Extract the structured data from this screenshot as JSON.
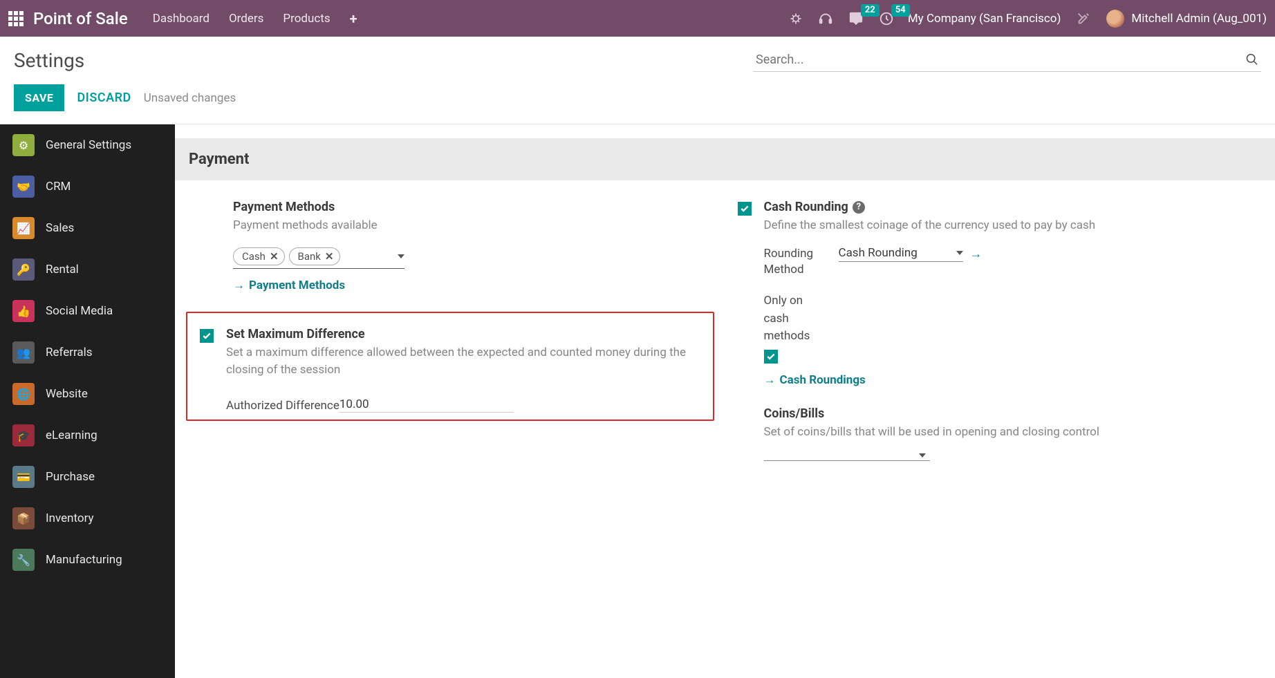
{
  "topbar": {
    "brand": "Point of Sale",
    "menu": [
      "Dashboard",
      "Orders",
      "Products"
    ],
    "badge_messages": "22",
    "badge_activities": "54",
    "company": "My Company (San Francisco)",
    "user": "Mitchell Admin (Aug_001)"
  },
  "page": {
    "title": "Settings",
    "search_placeholder": "Search...",
    "save": "SAVE",
    "discard": "DISCARD",
    "unsaved": "Unsaved changes"
  },
  "sidebar": {
    "items": [
      {
        "label": "General Settings",
        "color": "#8fae3e"
      },
      {
        "label": "CRM",
        "color": "#4b5ea3"
      },
      {
        "label": "Sales",
        "color": "#d98a2b"
      },
      {
        "label": "Rental",
        "color": "#5a5a7a"
      },
      {
        "label": "Social Media",
        "color": "#c9325a"
      },
      {
        "label": "Referrals",
        "color": "#5a5a5a"
      },
      {
        "label": "Website",
        "color": "#c96a2b"
      },
      {
        "label": "eLearning",
        "color": "#9b2b3a"
      },
      {
        "label": "Purchase",
        "color": "#5a7a8a"
      },
      {
        "label": "Inventory",
        "color": "#7a4a3a"
      },
      {
        "label": "Manufacturing",
        "color": "#4a7a5a"
      }
    ]
  },
  "section": {
    "title": "Payment"
  },
  "payment_methods": {
    "title": "Payment Methods",
    "desc": "Payment methods available",
    "tags": [
      "Cash",
      "Bank"
    ],
    "link": "Payment Methods"
  },
  "cash_rounding": {
    "title": "Cash Rounding",
    "desc": "Define the smallest coinage of the currency used to pay by cash",
    "field_label": "Rounding Method",
    "field_value": "Cash Rounding",
    "only_cash_label": "Only on cash methods",
    "link": "Cash Roundings"
  },
  "max_diff": {
    "title": "Set Maximum Difference",
    "desc": "Set a maximum difference allowed between the expected and counted money during the closing of the session",
    "auth_label": "Authorized Difference",
    "auth_value": "10.00"
  },
  "coins": {
    "title": "Coins/Bills",
    "desc": "Set of coins/bills that will be used in opening and closing control"
  }
}
